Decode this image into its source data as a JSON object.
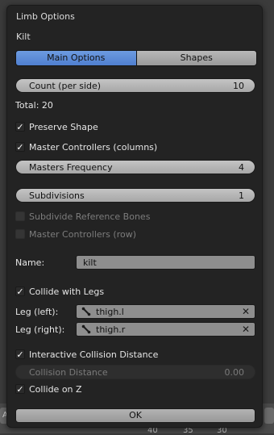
{
  "dialog": {
    "title": "Limb Options",
    "subtitle": "Kilt",
    "tabs": [
      {
        "label": "Main Options",
        "active": true
      },
      {
        "label": "Shapes",
        "active": false
      }
    ],
    "count": {
      "label": "Count (per side)",
      "value": "10"
    },
    "total": "Total: 20",
    "preserve_shape": {
      "label": "Preserve Shape",
      "checked": true
    },
    "master_controllers_columns": {
      "label": "Master Controllers (columns)",
      "checked": true
    },
    "masters_frequency": {
      "label": "Masters Frequency",
      "value": "4"
    },
    "subdivisions": {
      "label": "Subdivisions",
      "value": "1"
    },
    "subdivide_reference_bones": {
      "label": "Subdivide Reference Bones",
      "checked": false
    },
    "master_controllers_row": {
      "label": "Master Controllers (row)",
      "checked": false
    },
    "name": {
      "label": "Name:",
      "value": "kilt"
    },
    "collide_with_legs": {
      "label": "Collide with Legs",
      "checked": true
    },
    "leg_left": {
      "label": "Leg (left):",
      "value": "thigh.l"
    },
    "leg_right": {
      "label": "Leg (right):",
      "value": "thigh.r"
    },
    "interactive_collision_distance": {
      "label": "Interactive Collision Distance",
      "checked": true
    },
    "collision_distance": {
      "label": "Collision Distance",
      "value": "0.00"
    },
    "collide_on_z": {
      "label": "Collide on Z",
      "checked": true
    },
    "ok_label": "OK"
  },
  "background": {
    "left_fragment": "A",
    "right_fragment": "",
    "numbers": [
      "40",
      "35",
      "30"
    ]
  },
  "colors": {
    "active_tab": "#5680cc",
    "panel": "#232323",
    "slider": "#b5b5b5"
  }
}
